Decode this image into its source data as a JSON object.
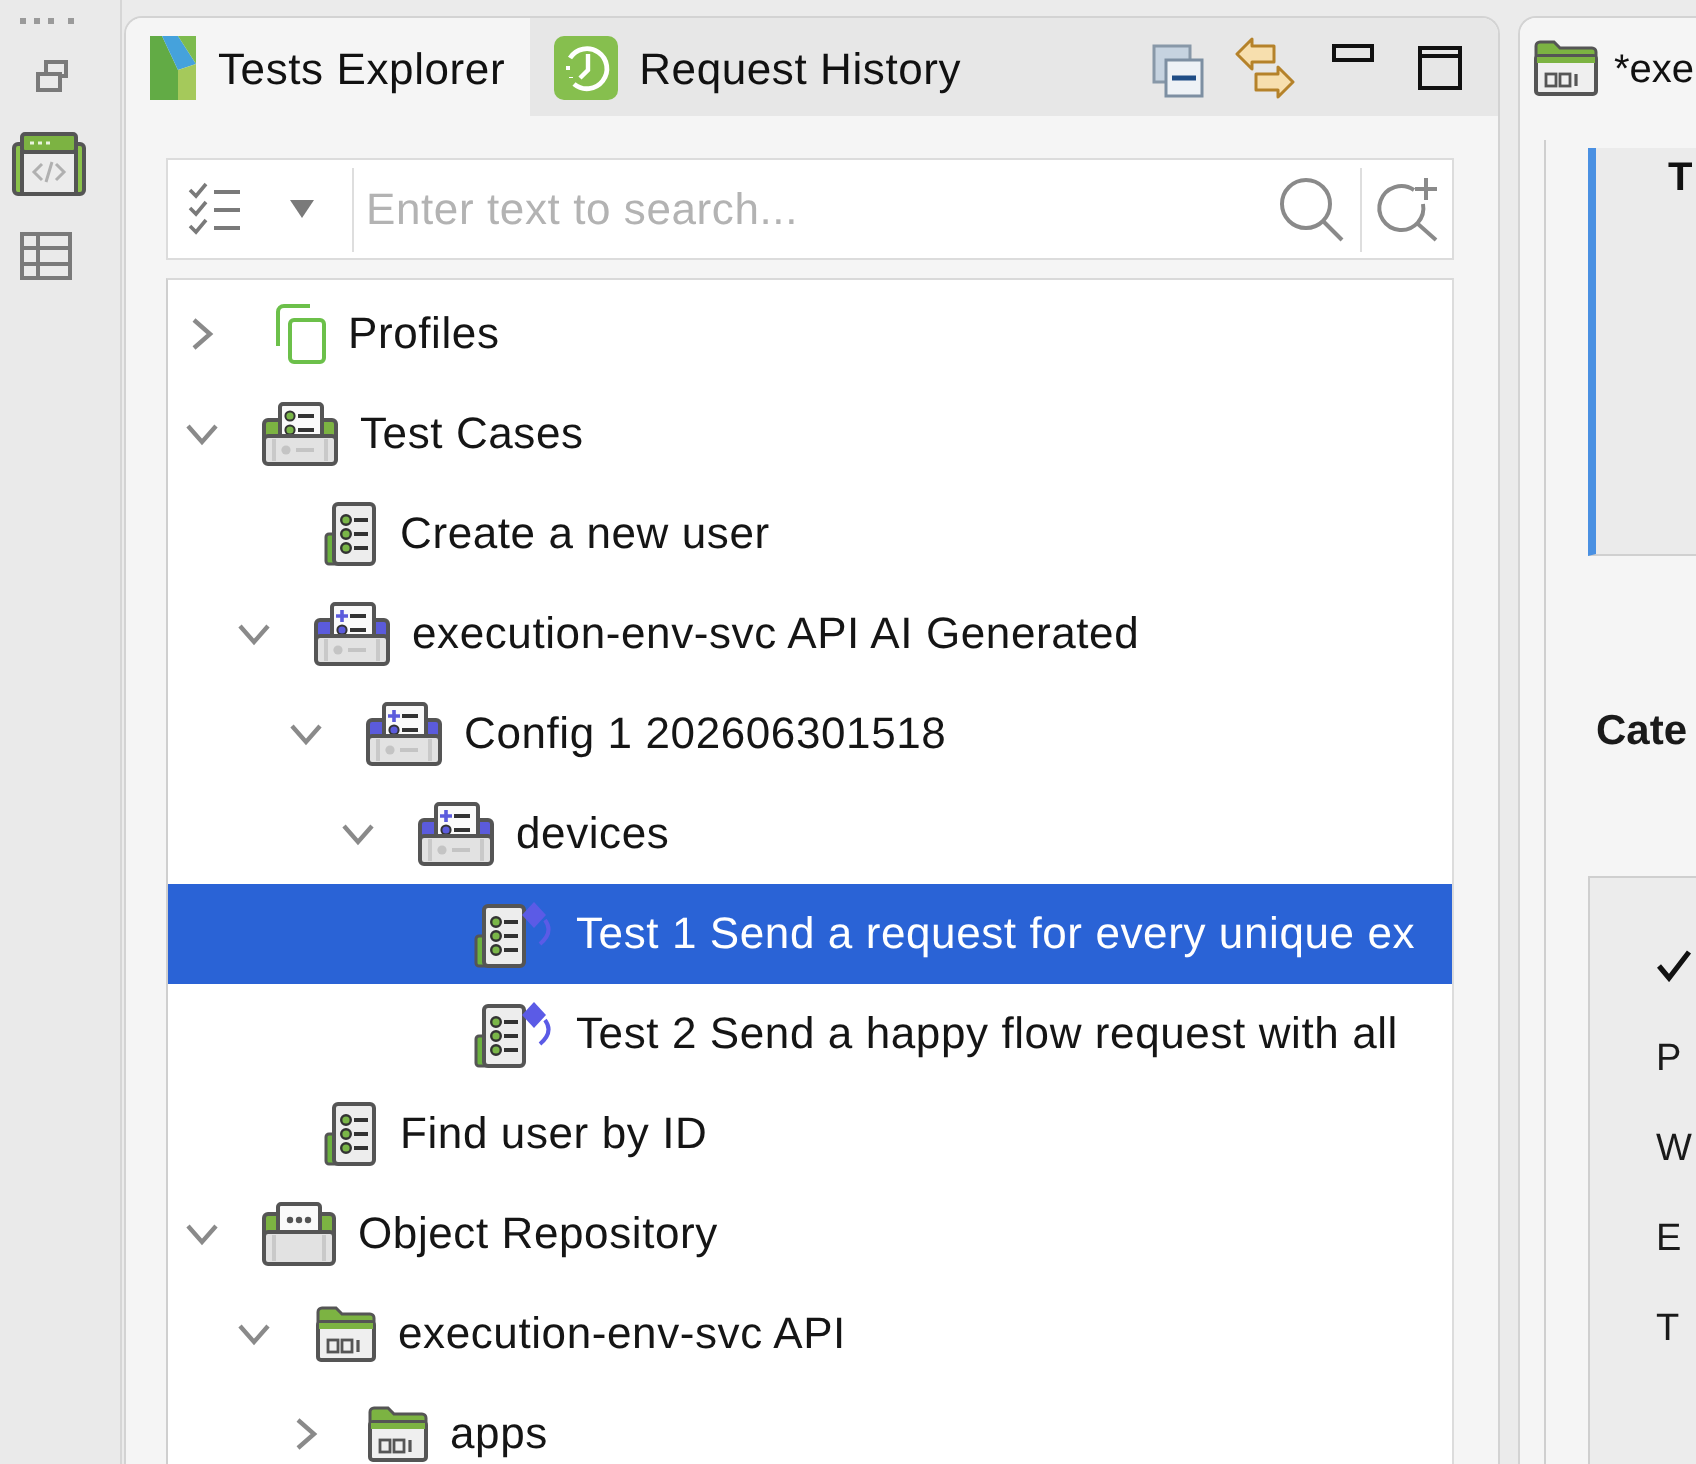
{
  "left_panel": {
    "tabs": [
      {
        "kind": "explorer",
        "label": "Tests Explorer",
        "selected": true
      },
      {
        "kind": "history",
        "label": "Request History",
        "selected": false
      }
    ],
    "search": {
      "placeholder": "Enter text to search..."
    },
    "tree": [
      {
        "kind": "profiles",
        "label": "Profiles",
        "expanded": false,
        "selected": false
      },
      {
        "kind": "suite",
        "label": "Test Cases",
        "expanded": true,
        "selected": false,
        "children": [
          {
            "kind": "test",
            "label": "Create a new user",
            "selected": false
          },
          {
            "kind": "ai-suite",
            "label": "execution-env-svc API AI Generated",
            "expanded": true,
            "selected": false,
            "children": [
              {
                "kind": "ai-suite",
                "label": "Config 1 202606301518",
                "expanded": true,
                "selected": false,
                "children": [
                  {
                    "kind": "ai-suite",
                    "label": "devices",
                    "expanded": true,
                    "selected": false,
                    "children": [
                      {
                        "kind": "ai-test",
                        "label": "Test 1 Send a request for every unique ex",
                        "selected": true
                      },
                      {
                        "kind": "ai-test",
                        "label": "Test 2 Send a happy flow request with all",
                        "selected": false
                      }
                    ]
                  }
                ]
              }
            ]
          },
          {
            "kind": "test",
            "label": "Find user by ID",
            "selected": false
          }
        ]
      },
      {
        "kind": "repository",
        "label": "Object Repository",
        "expanded": true,
        "selected": false,
        "children": [
          {
            "kind": "api-folder",
            "label": "execution-env-svc API",
            "expanded": true,
            "selected": false,
            "children": [
              {
                "kind": "api-folder",
                "label": "apps",
                "expanded": false,
                "selected": false
              }
            ]
          }
        ]
      }
    ]
  },
  "right_panel": {
    "tabs": [
      {
        "kind": "api",
        "label": "*exe",
        "selected": true
      }
    ],
    "card": {
      "title": "T"
    },
    "heading": "Cate",
    "options": [
      {
        "checked": true
      },
      {
        "label": "P",
        "checked": false
      },
      {
        "label": "W",
        "checked": false
      },
      {
        "label": "E",
        "checked": false
      },
      {
        "label": "T",
        "checked": false
      }
    ]
  }
}
